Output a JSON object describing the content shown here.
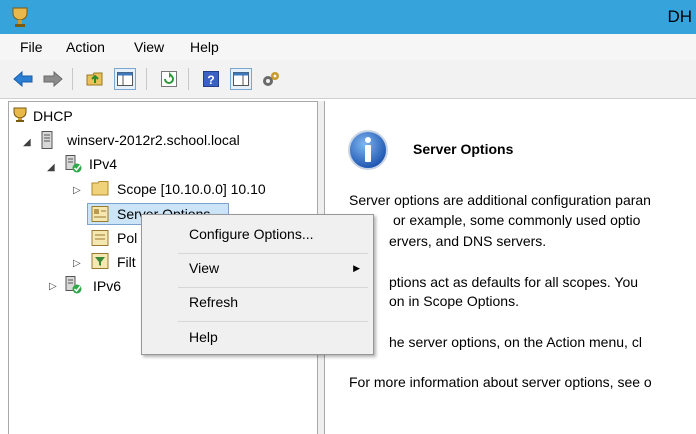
{
  "window": {
    "title": "DH"
  },
  "menu": [
    "File",
    "Action",
    "View",
    "Help"
  ],
  "toolbar": {
    "icons": [
      "back-icon",
      "forward-icon",
      "up-folder-icon",
      "show-hide-tree-icon",
      "refresh-icon",
      "help-icon",
      "action-pane-icon",
      "configure-icon"
    ]
  },
  "tree": {
    "root": "DHCP",
    "server": "winserv-2012r2.school.local",
    "ipv4": "IPv4",
    "scope": "Scope [10.10.0.0] 10.10",
    "server_options": "Server Options",
    "policies": "Pol",
    "filters": "Filt",
    "ipv6": "IPv6"
  },
  "detail": {
    "title": "Server Options",
    "lines": [
      "Server options are additional configuration paran",
      "or example, some commonly used optio",
      "ervers, and DNS servers.",
      "ptions act as defaults for all scopes.  You",
      "on in Scope Options.",
      "he server options, on the Action menu, cl",
      "For more information about server options, see o"
    ]
  },
  "context_menu": {
    "configure": "Configure Options...",
    "view": "View",
    "refresh": "Refresh",
    "help": "Help"
  },
  "colors": {
    "titlebar": "#36a3db",
    "selection": "#cce4f7"
  }
}
